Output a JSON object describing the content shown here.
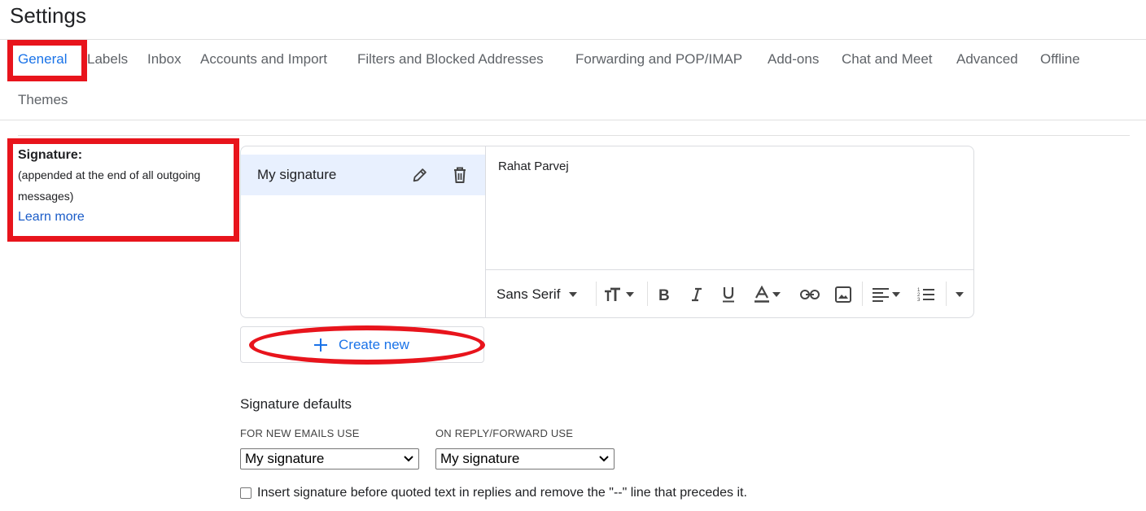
{
  "page": {
    "title": "Settings"
  },
  "tabs": [
    {
      "label": "General",
      "active": true
    },
    {
      "label": "Labels"
    },
    {
      "label": "Inbox"
    },
    {
      "label": "Accounts and Import"
    },
    {
      "label": "Filters and Blocked Addresses"
    },
    {
      "label": "Forwarding and POP/IMAP"
    },
    {
      "label": "Add-ons"
    },
    {
      "label": "Chat and Meet"
    },
    {
      "label": "Advanced"
    },
    {
      "label": "Offline"
    },
    {
      "label": "Themes"
    }
  ],
  "signature": {
    "title": "Signature:",
    "description": "(appended at the end of all outgoing messages)",
    "learn_more": "Learn more",
    "list": [
      {
        "name": "My signature"
      }
    ],
    "editor_text": "Rahat Parvej",
    "font": "Sans Serif",
    "create_new": "Create new"
  },
  "defaults": {
    "title": "Signature defaults",
    "new_label": "FOR NEW EMAILS USE",
    "new_value": "My signature",
    "reply_label": "ON REPLY/FORWARD USE",
    "reply_value": "My signature",
    "insert_text": "Insert signature before quoted text in replies and remove the \"--\" line that precedes it."
  },
  "colors": {
    "accent": "#1a73e8",
    "highlight": "#e8141c",
    "selected": "#e8f0fe",
    "link": "#1a5cc8"
  }
}
